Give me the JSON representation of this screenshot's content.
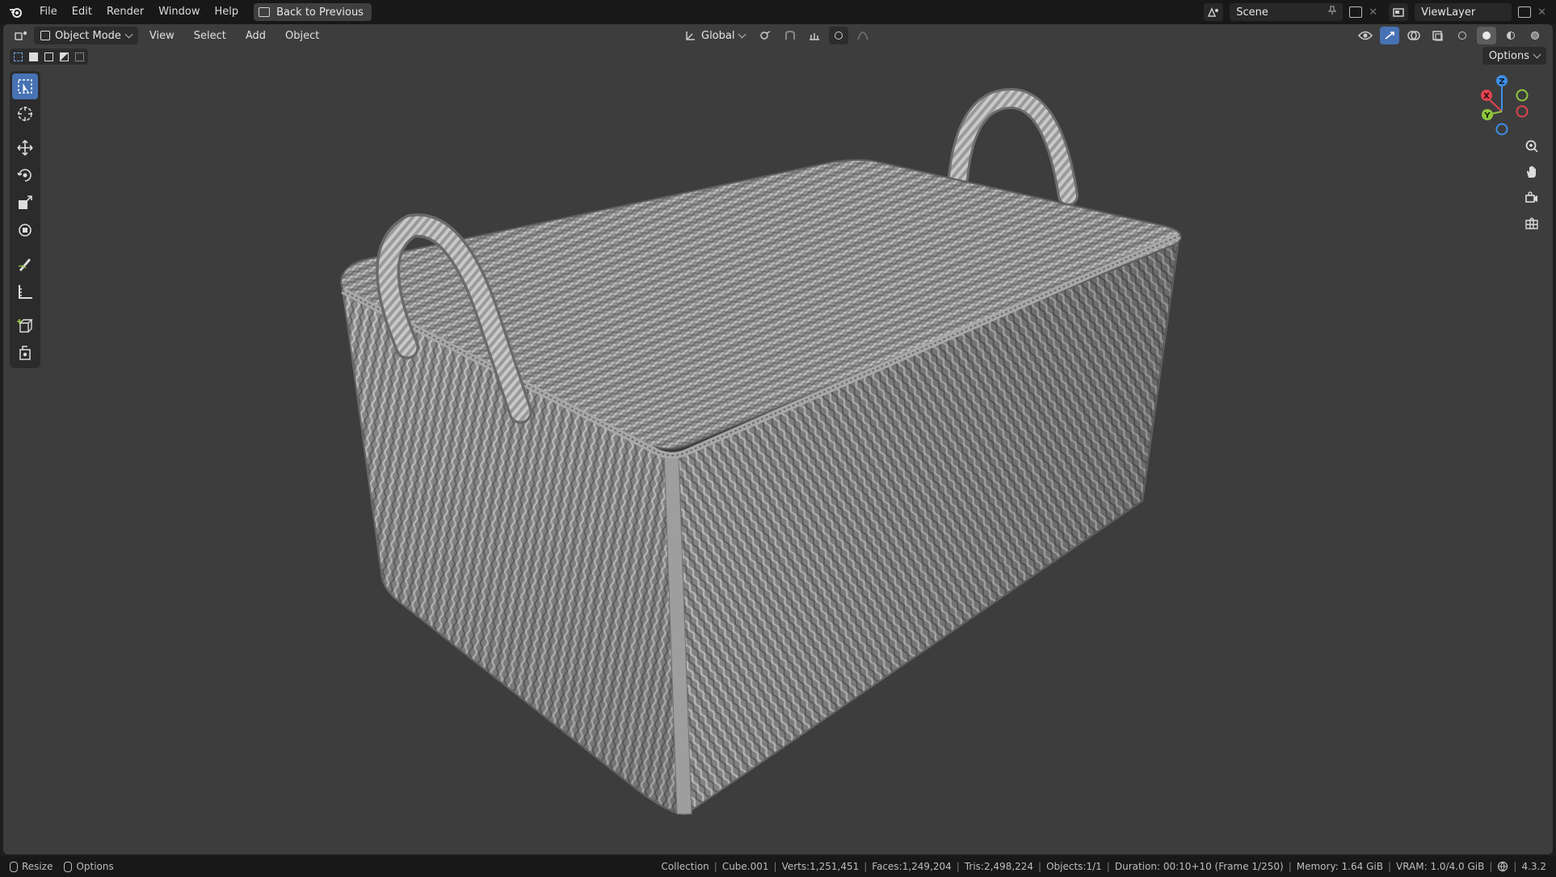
{
  "topbar": {
    "menus": [
      "File",
      "Edit",
      "Render",
      "Window",
      "Help"
    ],
    "back_label": "Back to Previous",
    "scene": "Scene",
    "view_layer": "ViewLayer"
  },
  "viewport_header": {
    "mode": "Object Mode",
    "menus": [
      "View",
      "Select",
      "Add",
      "Object"
    ],
    "orientation": "Global",
    "options_label": "Options"
  },
  "toolbar": {
    "tools": [
      "select-box",
      "cursor",
      "move",
      "rotate",
      "scale",
      "transform",
      "annotate",
      "measure",
      "add-cube",
      "add-object"
    ],
    "active": "select-box"
  },
  "gizmo": {
    "axes": [
      "Z",
      "X",
      "Y"
    ]
  },
  "statusbar": {
    "left": [
      "Resize",
      "Options"
    ],
    "stats": [
      "Collection",
      "Cube.001",
      "Verts:1,251,451",
      "Faces:1,249,204",
      "Tris:2,498,224",
      "Objects:1/1",
      "Duration: 00:10+10 (Frame 1/250)",
      "Memory: 1.64 GiB",
      "VRAM: 1.0/4.0 GiB"
    ],
    "version": "4.3.2"
  },
  "colors": {
    "accent": "#4772b3",
    "viewport_bg": "#3d3d3d",
    "axis_x": "#e2434e",
    "axis_y": "#8fc640",
    "axis_z": "#3d8fe6"
  }
}
